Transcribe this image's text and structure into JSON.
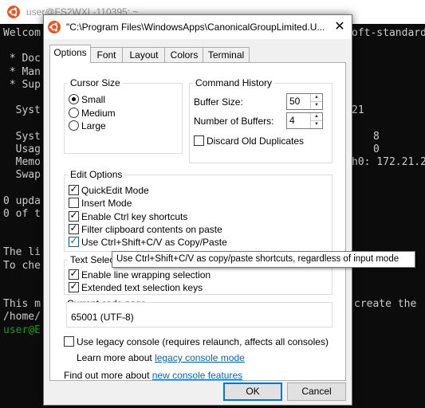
{
  "console": {
    "title": "user@FS2WXL-110395: ~",
    "lines": [
      {
        "text": "Welcom",
        "green": false
      },
      {
        "text": "",
        "green": false
      },
      {
        "text": " * Doc",
        "green": false
      },
      {
        "text": " * Man",
        "green": false
      },
      {
        "text": " * Sup",
        "green": false
      },
      {
        "text": "",
        "green": false
      },
      {
        "text": "  Syst",
        "green": false
      },
      {
        "text": "",
        "green": false
      },
      {
        "text": "  Syst",
        "green": false
      },
      {
        "text": "  Usag",
        "green": false
      },
      {
        "text": "  Memo",
        "green": false
      },
      {
        "text": "  Swap",
        "green": false
      },
      {
        "text": "",
        "green": false
      },
      {
        "text": "0 upda",
        "green": false
      },
      {
        "text": "0 of t",
        "green": false
      },
      {
        "text": "",
        "green": false
      },
      {
        "text": "",
        "green": false
      },
      {
        "text": "The li",
        "green": false
      },
      {
        "text": "To che",
        "green": false
      },
      {
        "text": "",
        "green": false
      },
      {
        "text": "",
        "green": false
      },
      {
        "text": "This m",
        "green": false
      },
      {
        "text": "/home/",
        "green": false
      },
      {
        "text": "user@E",
        "green": true
      }
    ],
    "right_lines": [
      {
        "text": "oft-standard",
        "row": 0
      },
      {
        "text": "21",
        "row": 6
      },
      {
        "text": "8",
        "row": 8
      },
      {
        "text": "0",
        "row": 9
      },
      {
        "text": "h0: 172.21.2",
        "row": 10
      },
      {
        "text": "create the",
        "row": 21
      }
    ]
  },
  "dialog": {
    "title": "\"C:\\Program Files\\WindowsApps\\CanonicalGroupLimited.U...",
    "close_glyph": "✕",
    "tabs": [
      "Options",
      "Font",
      "Layout",
      "Colors",
      "Terminal"
    ],
    "active_tab": "Options",
    "cursor_size": {
      "label": "Cursor Size",
      "options": [
        "Small",
        "Medium",
        "Large"
      ],
      "selected": "Small"
    },
    "command_history": {
      "label": "Command History",
      "buffer_size_label": "Buffer Size:",
      "buffer_size_value": "50",
      "num_buffers_label": "Number of Buffers:",
      "num_buffers_value": "4",
      "discard_label": "Discard Old Duplicates",
      "discard_checked": false
    },
    "edit_options": {
      "label": "Edit Options",
      "items": [
        {
          "label": "QuickEdit Mode",
          "checked": true
        },
        {
          "label": "Insert Mode",
          "checked": false
        },
        {
          "label": "Enable Ctrl key shortcuts",
          "checked": true
        },
        {
          "label": "Filter clipboard contents on paste",
          "checked": true
        },
        {
          "label": "Use Ctrl+Shift+C/V as Copy/Paste",
          "checked": true
        }
      ]
    },
    "text_selection": {
      "label": "Text Selection",
      "items": [
        {
          "label": "Enable line wrapping selection",
          "checked": true
        },
        {
          "label": "Extended text selection keys",
          "checked": true
        }
      ]
    },
    "code_page": {
      "label": "Current code page",
      "value": "65001 (UTF-8)"
    },
    "legacy": {
      "label": "Use legacy console (requires relaunch, affects all consoles)",
      "checked": false,
      "learn_prefix": "Learn more about ",
      "learn_link": "legacy console mode"
    },
    "find_out_prefix": "Find out more about ",
    "find_out_link": "new console features",
    "ok_label": "OK",
    "cancel_label": "Cancel"
  },
  "tooltip": "Use Ctrl+Shift+C/V as copy/paste shortcuts, regardless of input mode",
  "colors": {
    "ubuntu_orange": "#e95420",
    "link_blue": "#0066cc",
    "accent_blue": "#0078d7"
  },
  "icons": [
    "ubuntu-icon",
    "close-icon",
    "check-icon",
    "radio-dot-icon",
    "spin-up-icon",
    "spin-down-icon"
  ]
}
